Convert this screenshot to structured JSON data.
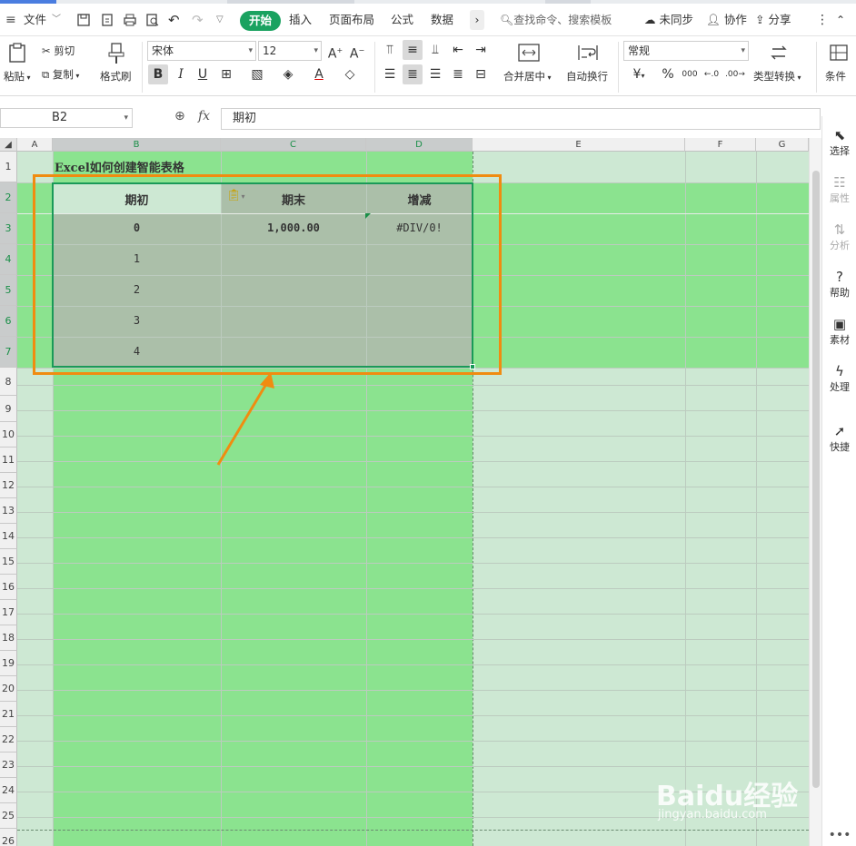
{
  "menubar": {
    "file": "文件",
    "tabs": [
      "开始",
      "插入",
      "页面布局",
      "公式",
      "数据"
    ],
    "search_placeholder": "查找命令、搜索模板",
    "unsynced": "未同步",
    "collaborate": "协作",
    "share": "分享"
  },
  "ribbon": {
    "paste": "粘贴",
    "cut": "剪切",
    "copy": "复制",
    "format_painter": "格式刷",
    "font_name": "宋体",
    "font_size": "12",
    "merge_center": "合并居中",
    "wrap_text": "自动换行",
    "number_format": "常规",
    "type_convert": "类型转换",
    "conditional": "条件",
    "currency": "¥",
    "percent": "%",
    "thousands": "000"
  },
  "formula_bar": {
    "name_box": "B2",
    "fx": "fx",
    "content": "期初"
  },
  "sheet": {
    "columns": [
      "A",
      "B",
      "C",
      "D",
      "E",
      "F",
      "G"
    ],
    "rows": [
      "1",
      "2",
      "3",
      "4",
      "5",
      "6",
      "7",
      "8",
      "9",
      "10",
      "11",
      "12",
      "13",
      "14",
      "15",
      "16",
      "17",
      "18",
      "19",
      "20",
      "21",
      "22",
      "23",
      "24",
      "25",
      "26"
    ],
    "title_cell": "Excel如何创建智能表格",
    "headers": [
      "期初",
      "期末",
      "增减"
    ],
    "row3": [
      "0",
      "1,000.00",
      "#DIV/0!"
    ],
    "serials": [
      "1",
      "2",
      "3",
      "4"
    ]
  },
  "right_panel": [
    "选择",
    "属性",
    "分析",
    "帮助",
    "素材",
    "处理",
    "快捷"
  ],
  "watermark": {
    "brand": "Baidu经验",
    "url": "jingyan.baidu.com"
  },
  "colors": {
    "accent": "#1aa260",
    "green_fill": "#8be38f",
    "light_green": "#cde8d3",
    "table_gray": "#abbfa9",
    "annotation_orange": "#f08c10"
  }
}
